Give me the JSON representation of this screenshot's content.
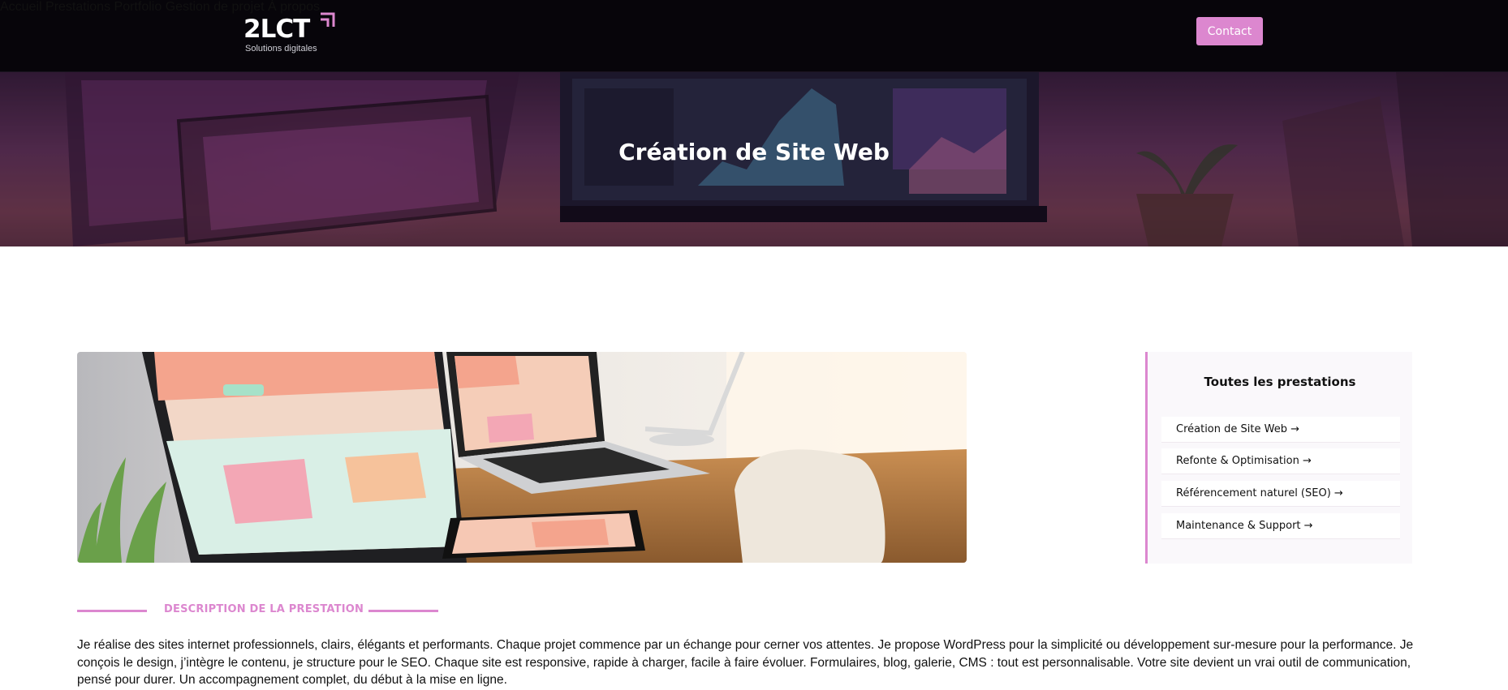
{
  "header": {
    "logo_text": "2LCT",
    "logo_tagline": "Solutions digitales",
    "nav": [
      "Accueil",
      "Prestations",
      "Portfolio",
      "Gestion de projet",
      "À propos"
    ],
    "contact_label": "Contact",
    "accent_color": "#dc87cf"
  },
  "hero": {
    "title": "Création de Site Web"
  },
  "sidebar": {
    "title": "Toutes les prestations",
    "items": [
      {
        "label": "Création de Site Web →"
      },
      {
        "label": "Refonte & Optimisation →"
      },
      {
        "label": "Référencement naturel (SEO) →"
      },
      {
        "label": "Maintenance & Support →"
      }
    ]
  },
  "description": {
    "heading": "DESCRIPTION DE LA PRESTATION",
    "body": "Je réalise des sites internet professionnels, clairs, élégants et performants. Chaque projet commence par un échange pour cerner vos attentes. Je propose WordPress pour la simplicité ou développement sur-mesure pour la performance. Je conçois le design, j’intègre le contenu, je structure pour le SEO. Chaque site est responsive, rapide à charger, facile à faire évoluer. Formulaires, blog, galerie, CMS : tout est personnalisable. Votre site devient un vrai outil de communication, pensé pour durer. Un accompagnement complet, du début à la mise en ligne."
  }
}
